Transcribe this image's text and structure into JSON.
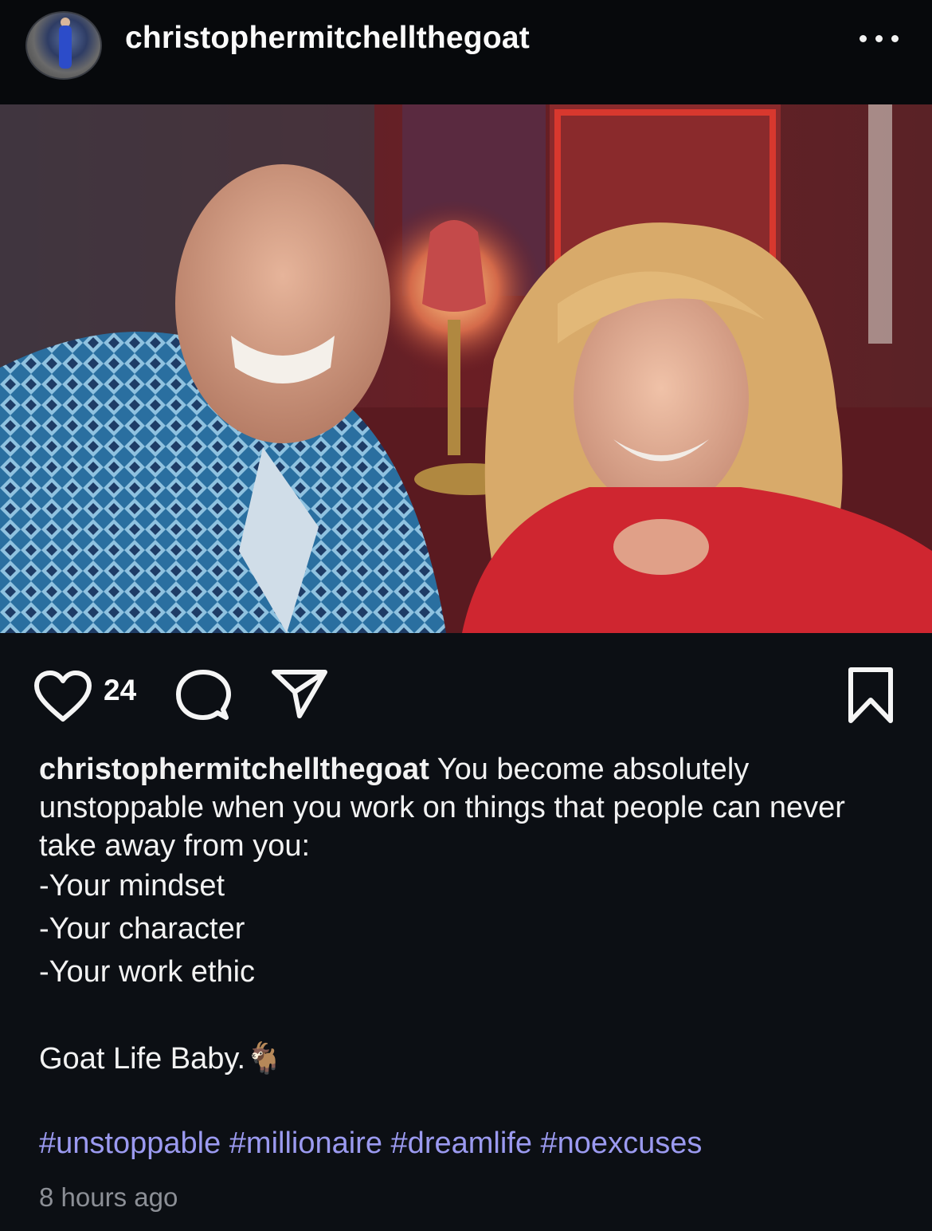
{
  "post": {
    "username": "christophermitchellthegoat",
    "likes": "24",
    "caption_user": "christophermitchellthegoat",
    "caption_text": " You become absolutely unstoppable when you work on things that people can never take away from you:",
    "list": [
      "-Your mindset",
      "-Your character",
      "-Your work ethic"
    ],
    "closing": "Goat Life Baby.",
    "closing_emoji": "🐐",
    "hashtags": [
      "#unstoppable",
      "#millionaire",
      "#dreamlife",
      "#noexcuses"
    ],
    "timestamp": "8 hours ago"
  },
  "icons": {
    "more": "more-options-icon",
    "like": "heart-icon",
    "comment": "comment-icon",
    "share": "share-icon",
    "save": "bookmark-icon"
  },
  "colors": {
    "background": "#0c0f14",
    "hashtag": "#9b9af0",
    "timestamp": "#8c8f96"
  }
}
